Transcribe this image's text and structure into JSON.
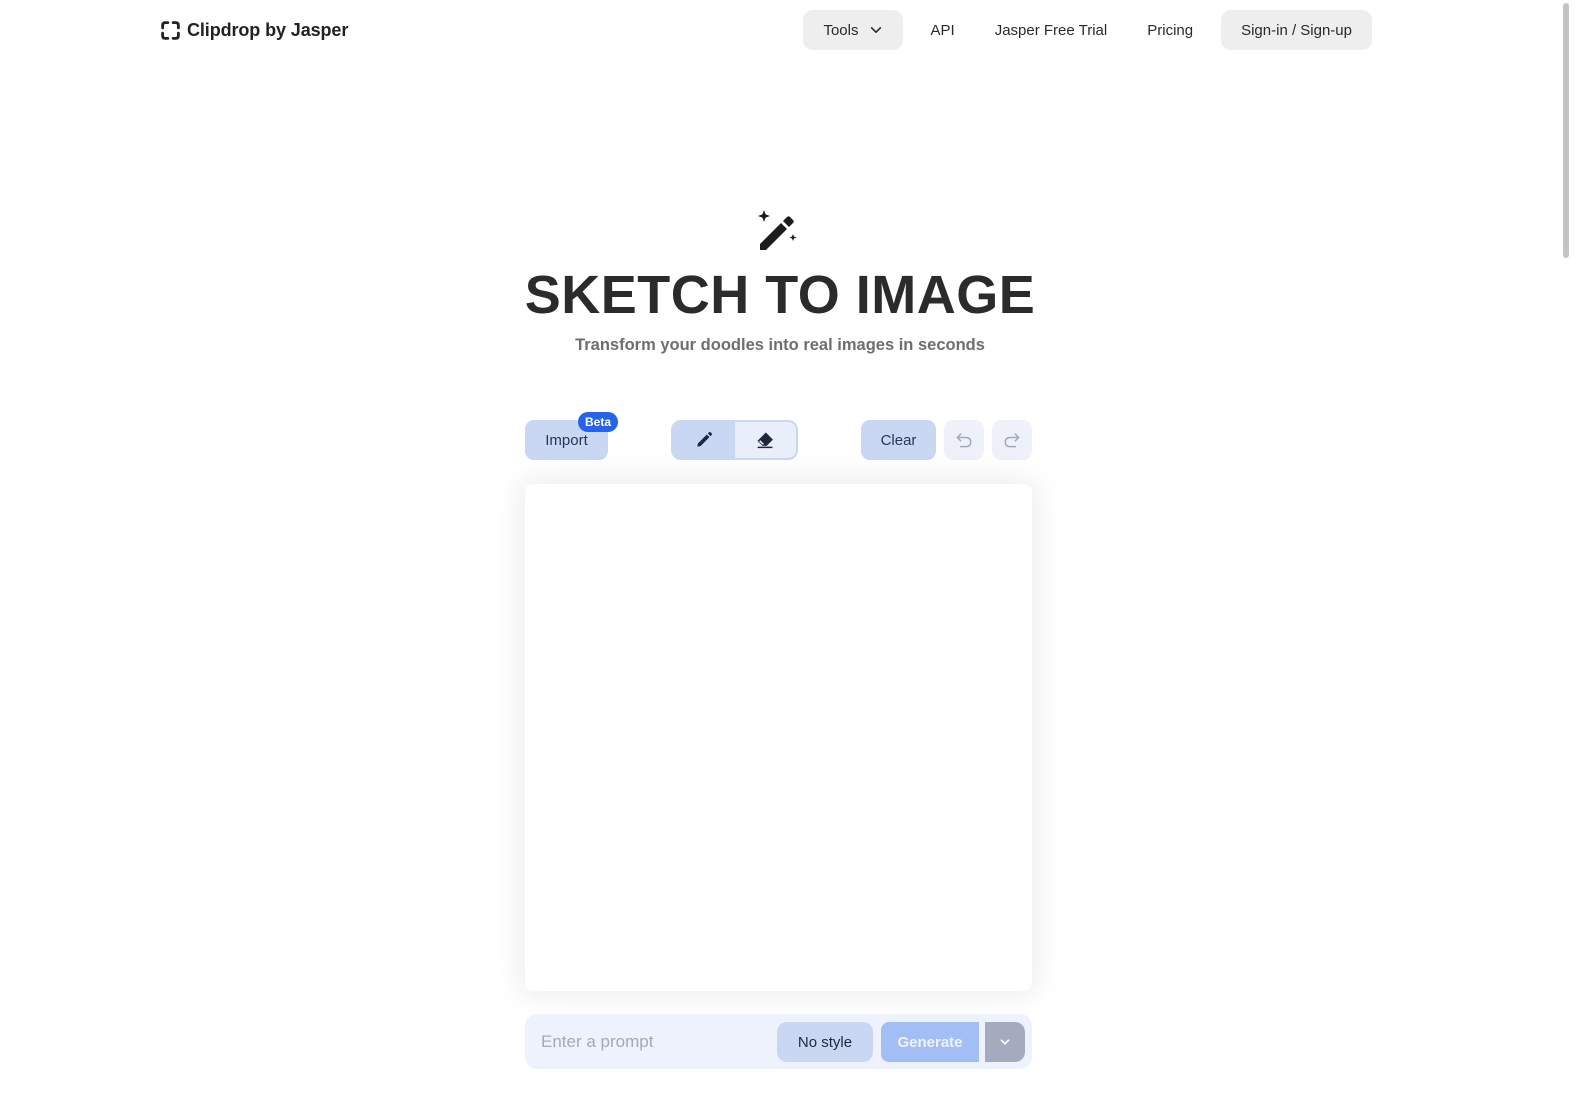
{
  "header": {
    "brand": "Clipdrop by Jasper",
    "logo_icon": "clipdrop-bracket-icon",
    "nav": [
      {
        "label": "Tools",
        "icon": "chevron-down-icon",
        "style": "pill"
      },
      {
        "label": "API"
      },
      {
        "label": "Jasper Free Trial"
      },
      {
        "label": "Pricing"
      },
      {
        "label": "Sign-in / Sign-up",
        "style": "pill"
      }
    ]
  },
  "hero": {
    "icon": "magic-wand-icon",
    "title": "SKETCH TO IMAGE",
    "subtitle": "Transform your doodles into real images in seconds"
  },
  "toolbar": {
    "import_label": "Import",
    "beta_badge": "Beta",
    "tools": [
      {
        "name": "pencil",
        "icon": "pencil-icon",
        "active": true
      },
      {
        "name": "eraser",
        "icon": "eraser-icon",
        "active": false
      }
    ],
    "clear_label": "Clear",
    "undo_icon": "undo-icon",
    "redo_icon": "redo-icon"
  },
  "prompt": {
    "value": "",
    "placeholder": "Enter a prompt",
    "style_label": "No style",
    "generate_label": "Generate",
    "more_icon": "chevron-down-icon"
  },
  "colors": {
    "accent": "#2563eb",
    "button_bg": "#c9d7f3",
    "generate_disabled": "#a3bdf5",
    "prompt_bar_bg": "#eef2fc"
  }
}
